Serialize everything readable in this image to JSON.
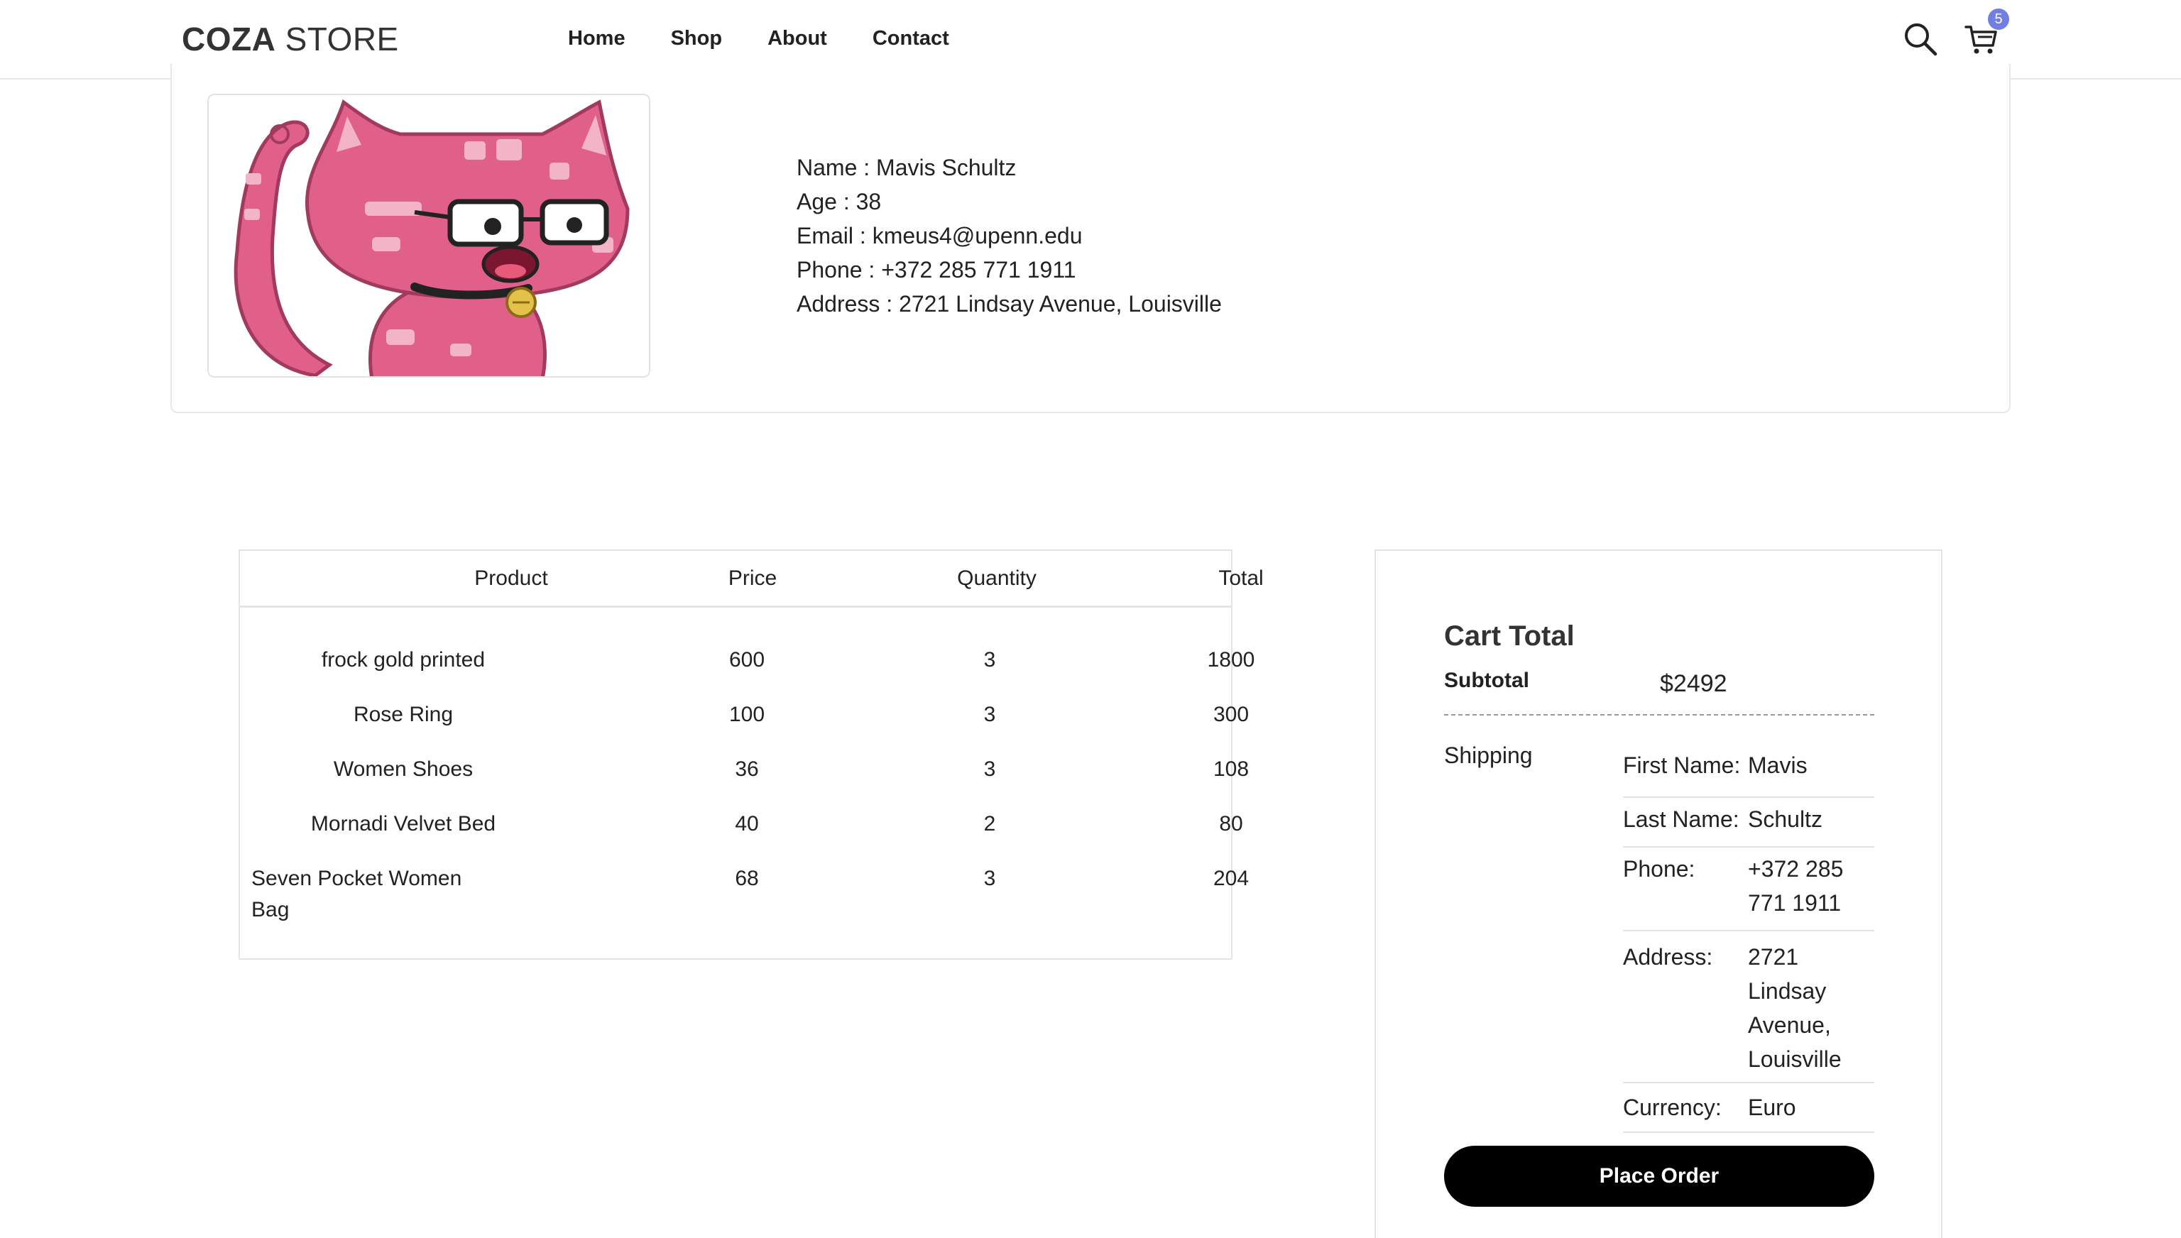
{
  "header": {
    "logo_bold": "COZA",
    "logo_regular": " STORE",
    "nav": [
      "Home",
      "Shop",
      "About",
      "Contact"
    ],
    "cart_count": "5"
  },
  "profile": {
    "name": "Name : Mavis Schultz",
    "age": "Age : 38",
    "email": "Email : kmeus4@upenn.edu",
    "phone": "Phone : +372 285 771 1911",
    "address": "Address : 2721 Lindsay Avenue, Louisville",
    "avatar_icon": "pink-cat-with-glasses-image"
  },
  "cart_table": {
    "headers": [
      "Product",
      "Price",
      "Quantity",
      "Total"
    ],
    "rows": [
      {
        "product": "frock gold printed",
        "price": "600",
        "quantity": "3",
        "total": "1800"
      },
      {
        "product": "Rose Ring",
        "price": "100",
        "quantity": "3",
        "total": "300"
      },
      {
        "product": "Women Shoes",
        "price": "36",
        "quantity": "3",
        "total": "108"
      },
      {
        "product": "Mornadi Velvet Bed",
        "price": "40",
        "quantity": "2",
        "total": "80"
      },
      {
        "product": "Seven Pocket Women Bag",
        "price": "68",
        "quantity": "3",
        "total": "204"
      }
    ]
  },
  "cart_total": {
    "title": "Cart Total",
    "subtotal_label": "Subtotal",
    "subtotal_value": "$2492",
    "shipping_label": "Shipping",
    "shipping": [
      {
        "key": "First Name:",
        "value": "Mavis"
      },
      {
        "key": "Last Name:",
        "value": "Schultz"
      },
      {
        "key": "Phone:",
        "value": "+372 285 771 1911"
      },
      {
        "key": "Address:",
        "value": "2721 Lindsay Avenue, Louisville"
      },
      {
        "key": "Currency:",
        "value": "Euro"
      }
    ],
    "place_order": "Place Order"
  },
  "colors": {
    "badge": "#717fe0",
    "button": "#000000",
    "avatar_pink": "#e0608a"
  }
}
